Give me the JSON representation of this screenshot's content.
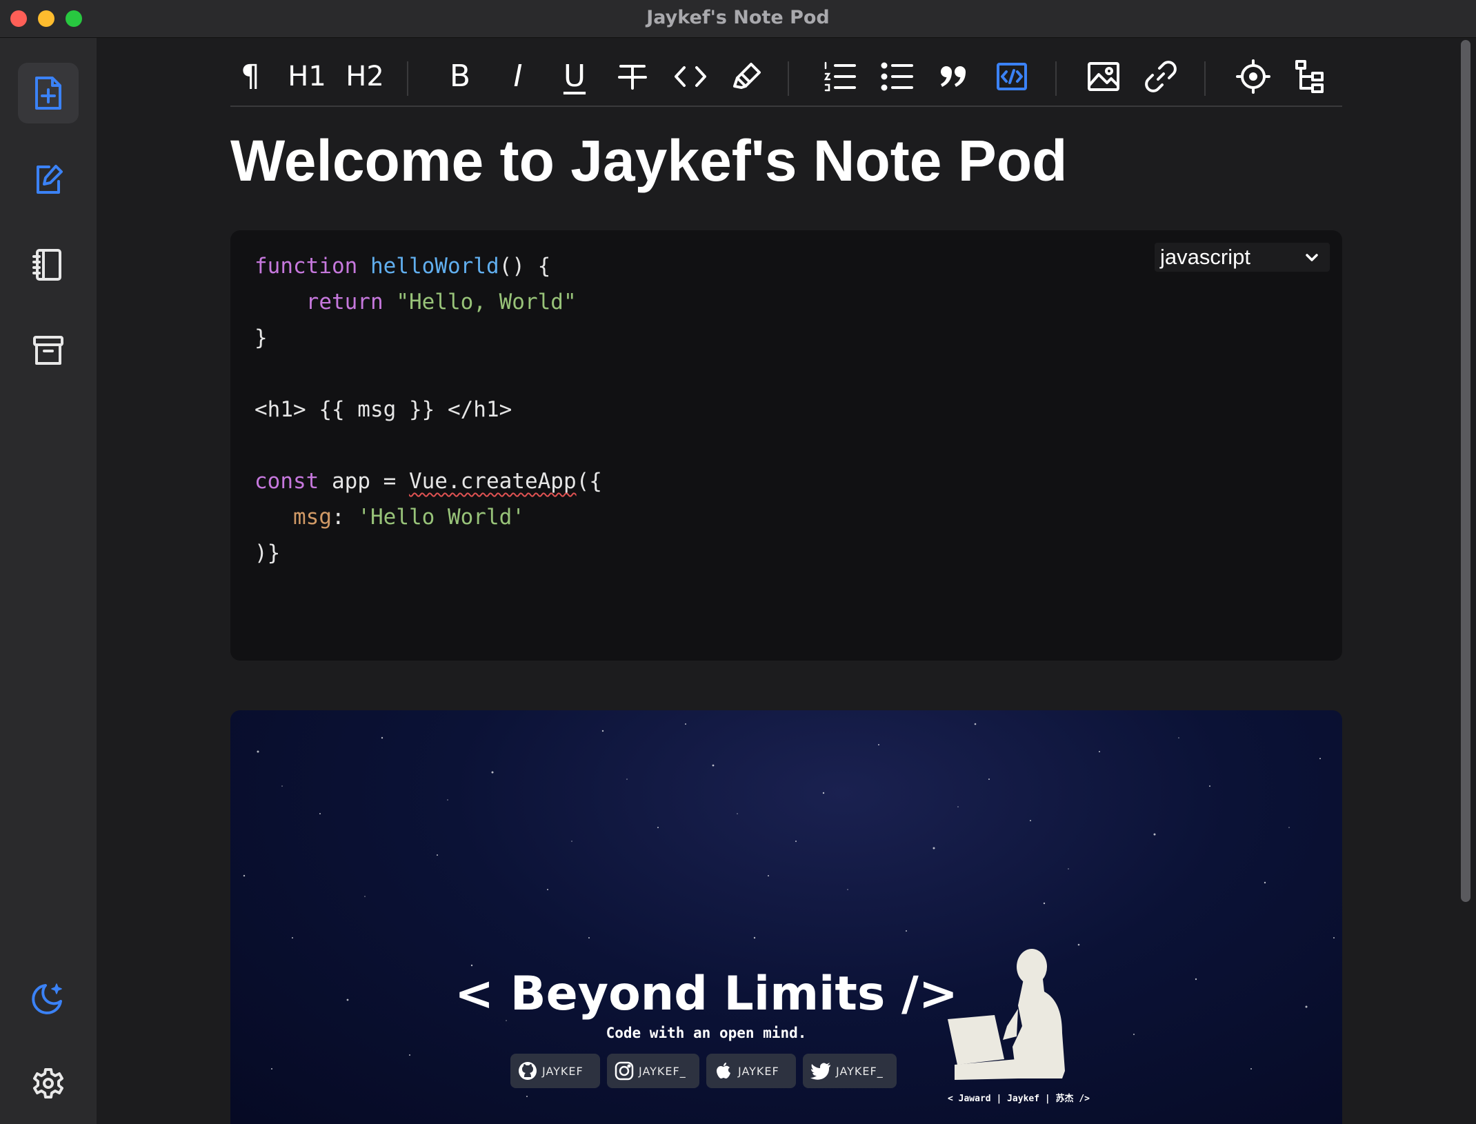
{
  "window": {
    "title": "Jaykef's Note Pod"
  },
  "sidebar": {
    "items": [
      {
        "icon": "new-note-icon",
        "active": true
      },
      {
        "icon": "edit-note-icon"
      },
      {
        "icon": "notebook-icon"
      },
      {
        "icon": "archive-icon"
      }
    ],
    "bottom": [
      {
        "icon": "moon-icon"
      },
      {
        "icon": "settings-icon"
      }
    ]
  },
  "toolbar": {
    "paragraph": "¶",
    "h1": "H1",
    "h2": "H2",
    "bold": "B",
    "italic": "I",
    "underline": "U",
    "active_tool": "code-block"
  },
  "editor": {
    "heading": "Welcome to Jaykef's Note Pod",
    "code_block": {
      "language": "javascript",
      "lines": {
        "l1_kw": "function",
        "l1_fn": "helloWorld",
        "l1_rest": "() {",
        "l2_indent": "    ",
        "l2_kw": "return",
        "l2_str": "\"Hello, World\"",
        "l3": "}",
        "l5": "<h1> {{ msg }} </h1>",
        "l7_kw": "const",
        "l7_mid": " app = ",
        "l7_err": "Vue.createApp",
        "l7_end": "({",
        "l8_indent": "   ",
        "l8_prop": "msg",
        "l8_colon": ": ",
        "l8_str": "'Hello World'",
        "l9": ")}"
      }
    },
    "banner": {
      "title": "< Beyond Limits />",
      "subtitle": "Code with an open mind.",
      "socials": [
        {
          "icon": "github-icon",
          "label": "JAYKEF"
        },
        {
          "icon": "instagram-icon",
          "label": "JAYKEF_"
        },
        {
          "icon": "apple-icon",
          "label": "JAYKEF"
        },
        {
          "icon": "twitter-icon",
          "label": "JAYKEF_"
        }
      ],
      "caption": "< Jaward | Jaykef | 苏杰 />"
    }
  },
  "colors": {
    "accent": "#3b82f6",
    "background": "#1c1c1e",
    "sidebar": "#2a2a2c",
    "code_bg": "#111113"
  }
}
